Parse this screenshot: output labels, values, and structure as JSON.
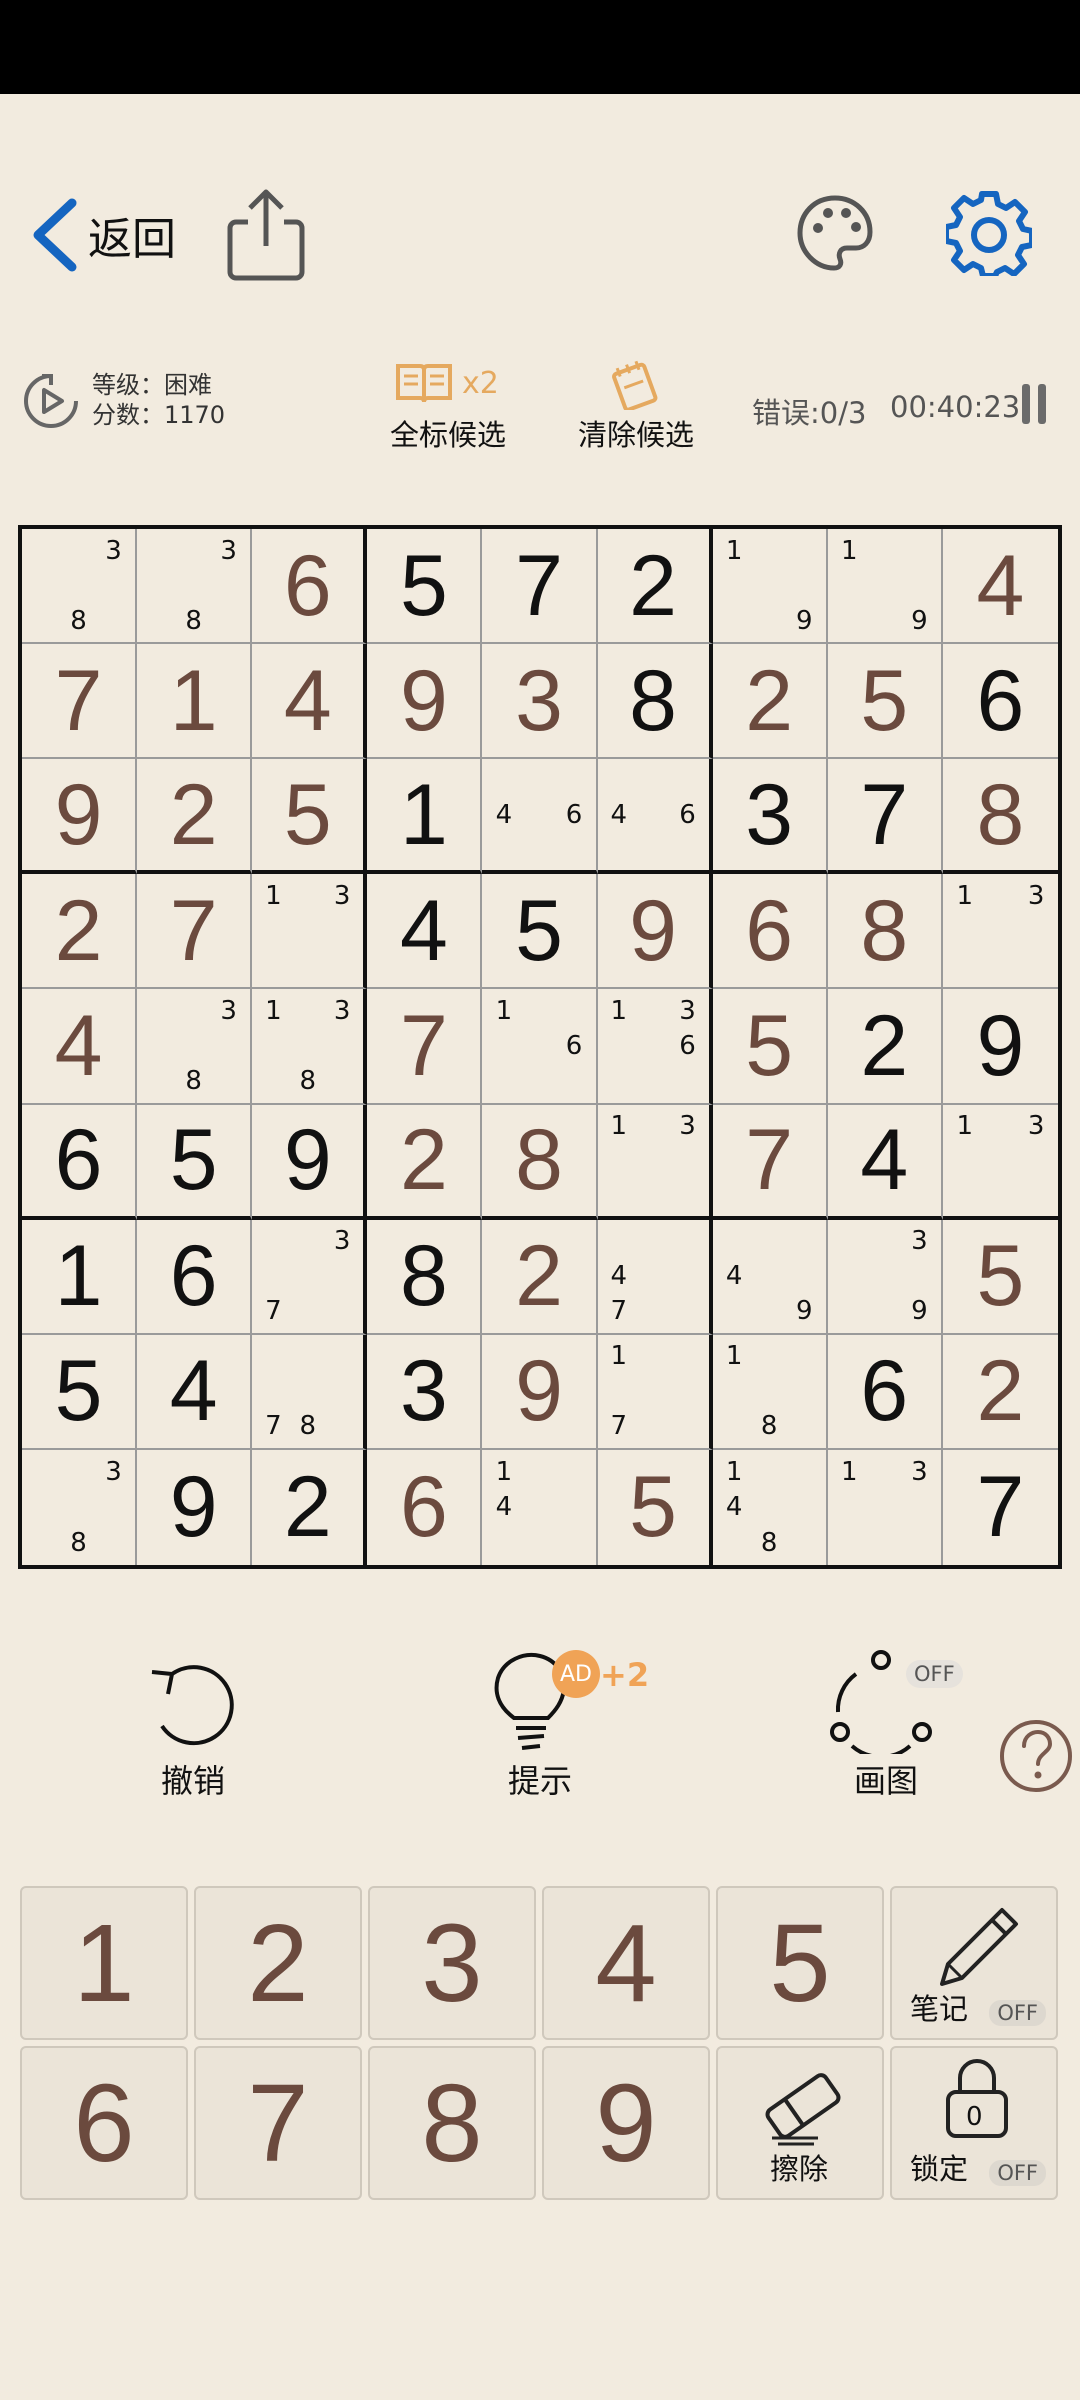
{
  "header": {
    "back_label": "返回"
  },
  "info": {
    "level_label": "等级：困难",
    "score_label": "分数：1170",
    "autonote_label": "全标候选",
    "autonote_multiplier": "x2",
    "clearnote_label": "清除候选",
    "errors": "错误:0/3",
    "timer": "00:40:23"
  },
  "board": {
    "cells": [
      [
        "n:3,8",
        "n:3,8",
        "u:6",
        "g:5",
        "g:7",
        "g:2",
        "n:1,9",
        "n:1,9",
        "u:4"
      ],
      [
        "u:7",
        "u:1",
        "u:4",
        "u:9",
        "u:3",
        "g:8",
        "u:2",
        "u:5",
        "g:6"
      ],
      [
        "u:9",
        "u:2",
        "u:5",
        "g:1",
        "n:4,6",
        "n:4,6",
        "g:3",
        "g:7",
        "u:8"
      ],
      [
        "u:2",
        "u:7",
        "n:1,3",
        "g:4",
        "g:5",
        "u:9",
        "u:6",
        "u:8",
        "n:1,3"
      ],
      [
        "u:4",
        "n:3,8",
        "n:1,3,8",
        "u:7",
        "n:1,6",
        "n:1,3,6",
        "u:5",
        "g:2",
        "g:9"
      ],
      [
        "g:6",
        "g:5",
        "g:9",
        "u:2",
        "u:8",
        "n:1,3",
        "u:7",
        "g:4",
        "n:1,3"
      ],
      [
        "g:1",
        "g:6",
        "n:3,7",
        "g:8",
        "u:2",
        "n:4,7",
        "n:4,9",
        "n:3,9",
        "u:5"
      ],
      [
        "g:5",
        "g:4",
        "n:7,8",
        "g:3",
        "u:9",
        "n:1,7",
        "n:1,8",
        "g:6",
        "u:2"
      ],
      [
        "n:3,8",
        "g:9",
        "g:2",
        "u:6",
        "n:1,4",
        "u:5",
        "n:1,4,8",
        "n:1,3",
        "g:7"
      ]
    ]
  },
  "actions": {
    "undo_label": "撤销",
    "hint_label": "提示",
    "hint_ad": "AD",
    "hint_bonus": "+2",
    "draw_label": "画图",
    "draw_state": "OFF"
  },
  "keypad": {
    "digits": [
      "1",
      "2",
      "3",
      "4",
      "5",
      "6",
      "7",
      "8",
      "9"
    ],
    "notes_label": "笔记",
    "notes_state": "OFF",
    "erase_label": "擦除",
    "lock_label": "锁定",
    "lock_state": "OFF",
    "lock_count": "0"
  },
  "colors": {
    "background": "#f2ebdf",
    "accent_blue": "#1565c0",
    "user_digit": "#6b4a3e",
    "orange": "#f0a356"
  }
}
